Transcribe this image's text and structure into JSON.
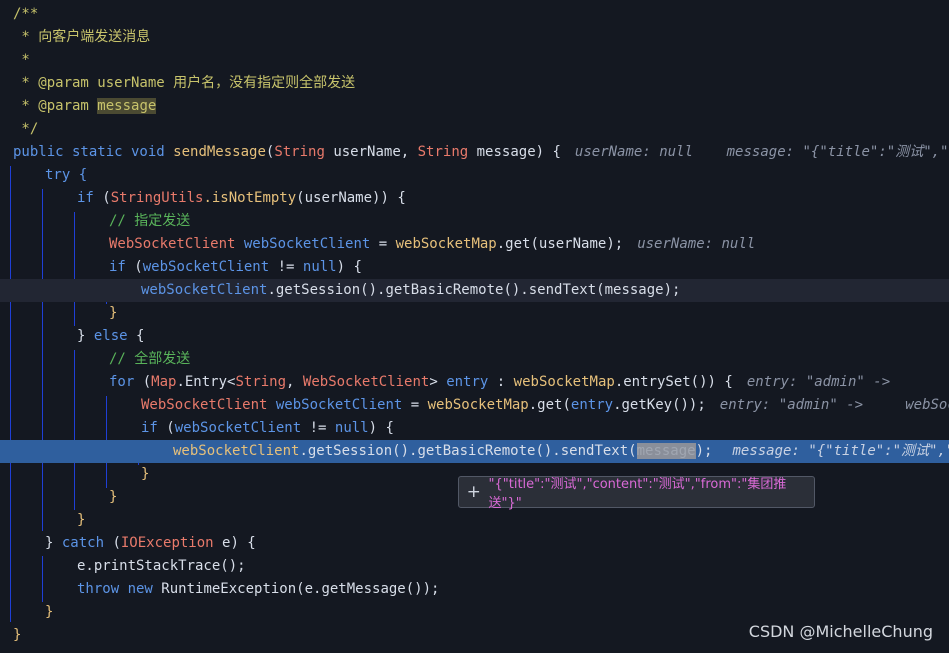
{
  "doc": {
    "l1": "/**",
    "l2": " * 向客户端发送消息",
    "l3": " *",
    "l4a": " * @param userName ",
    "l4b": "用户名，没有指定则全部发送",
    "l5a": " * @param ",
    "l5b": "message",
    "l6": " */"
  },
  "code": {
    "sig": {
      "kw": "public static void ",
      "fn": "sendMessage",
      "p1": "(",
      "t1": "String",
      "a1": " userName, ",
      "t2": "String",
      "a2": " message) {",
      "hint": "userName: null    message: \"{\"title\":\"测试\",\"conte"
    },
    "try_kw": "try {",
    "if1": {
      "kw": "if ",
      "p": "(",
      "cls": "StringUtils",
      "fn": ".isNotEmpty",
      "rest": "(userName)) {"
    },
    "cm1": "// 指定发送",
    "decl1": {
      "type": "WebSocketClient",
      "var": " webSocketClient",
      "eq": " = ",
      "map": "webSocketMap",
      "rest": ".get(userName);",
      "hint": "userName: null"
    },
    "if2": {
      "kw": "if ",
      "p": "(",
      "var": "webSocketClient",
      "mid": " != ",
      "nul": "null",
      "rest": ") {"
    },
    "send1": {
      "var": "webSocketClient",
      "rest": ".getSession().getBasicRemote().sendText(",
      "msg": "message",
      "end": ");"
    },
    "close1": "}",
    "else_line": {
      "b": "} ",
      "kw": "else",
      "rest": " {"
    },
    "cm2": "// 全部发送",
    "for_line": {
      "kw": "for ",
      "p": "(",
      "t1": "Map",
      "t1b": ".Entry<",
      "t2": "String",
      "c": ", ",
      "t3": "WebSocketClient",
      "gt": "> ",
      "var": "entry",
      "col": " : ",
      "map": "webSocketMap",
      "rest": ".entrySet()) {",
      "hint": "entry: \"admin\" ->"
    },
    "decl2": {
      "type": "WebSocketClient",
      "var": " webSocketClient",
      "eq": " = ",
      "map": "webSocketMap",
      "get": ".get(",
      "e": "entry",
      "rest": ".getKey());",
      "hint": "entry: \"admin\" ->     webSocketC"
    },
    "if3": {
      "kw": "if ",
      "p": "(",
      "var": "webSocketClient",
      "mid": " != ",
      "nul": "null",
      "rest": ") {"
    },
    "send2": {
      "var": "webSocketClient",
      "rest": ".getSession().getBasicRemote().sendText(",
      "msg": "message",
      "end": ");",
      "hint": "message: \"{\"title\":\"测试\",\"cont"
    },
    "close2": "}",
    "close3": "}",
    "close4": "}",
    "catch_line": {
      "b": "} ",
      "kw": "catch",
      "p": " (",
      "type": "IOException",
      "rest": " e) {"
    },
    "print": "e.printStackTrace();",
    "throw_line": {
      "kw": "throw new ",
      "rest": "RuntimeException(e.getMessage());"
    },
    "close5": "}",
    "close6": "}"
  },
  "tooltip": {
    "icon": "plus-icon",
    "plus": "+",
    "value": "\"{\"title\":\"测试\",\"content\":\"测试\",\"from\":\"集团推送\"}\""
  },
  "watermark": "CSDN @MichelleChung",
  "colors": {
    "background": "#141821",
    "keyword": "#5c94e6",
    "type": "#e87a6b",
    "comment": "#59b35a",
    "doc": "#c7c36b",
    "highlight": "#2f5f9e"
  }
}
